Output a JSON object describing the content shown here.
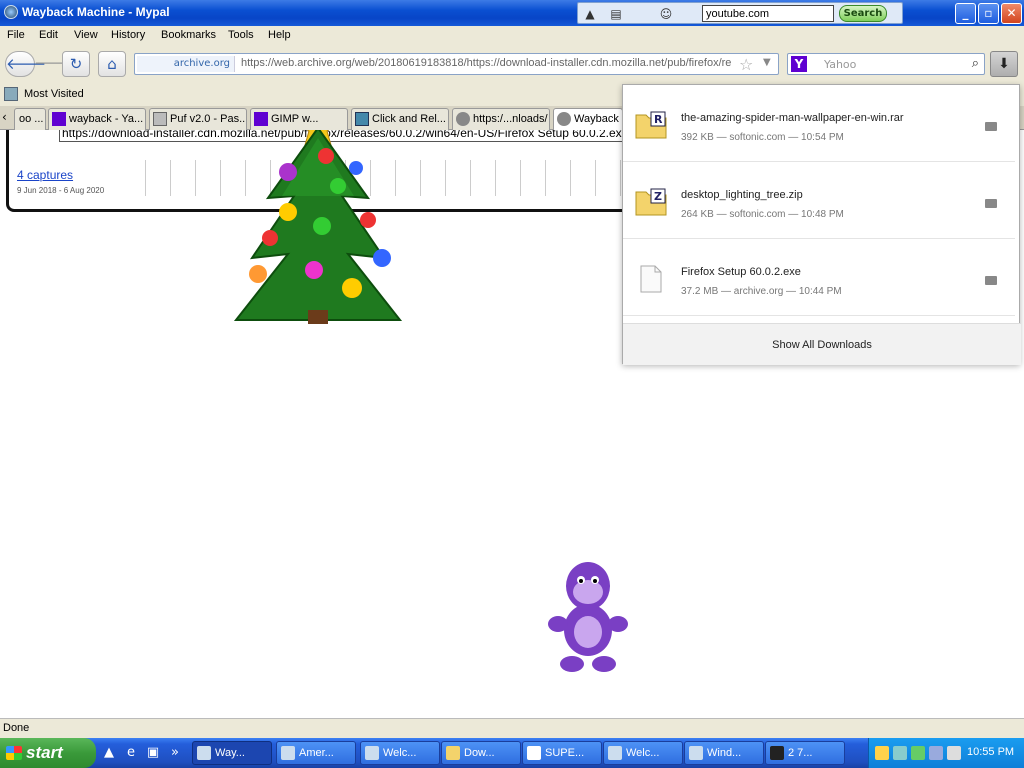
{
  "window": {
    "title": "Wayback Machine - Mypal"
  },
  "toolbar_strip": {
    "search_value": "youtube.com",
    "search_button": "Search"
  },
  "menu": [
    "File",
    "Edit",
    "View",
    "History",
    "Bookmarks",
    "Tools",
    "Help"
  ],
  "nav": {
    "identity": "archive.org",
    "url": "https://web.archive.org/web/20180619183818/https://download-installer.cdn.mozilla.net/pub/firefox/re",
    "search_engine": "Yahoo",
    "search_placeholder": "Yahoo"
  },
  "bookmarks": {
    "most_visited": "Most Visited"
  },
  "tabs": [
    {
      "label": "oo ..."
    },
    {
      "label": "wayback - Ya..."
    },
    {
      "label": "Puf v2.0 - Pas..."
    },
    {
      "label": "GIMP w..."
    },
    {
      "label": "Click and Rel..."
    },
    {
      "label": "https:/...nloads/"
    },
    {
      "label": "Wayback"
    }
  ],
  "page": {
    "url_text": "https://download-installer.cdn.mozilla.net/pub/firefox/releases/60.0.2/win64/en-US/Firefox Setup 60.0.2.exe",
    "captures": "4 captures",
    "dates": "9 Jun 2018 - 6 Aug 2020"
  },
  "downloads": {
    "items": [
      {
        "name": "the-amazing-spider-man-wallpaper-en-win.rar",
        "meta": "392 KB — softonic.com — 10:54 PM",
        "icon": "rar-icon"
      },
      {
        "name": "desktop_lighting_tree.zip",
        "meta": "264 KB — softonic.com — 10:48 PM",
        "icon": "zip-icon"
      },
      {
        "name": "Firefox Setup 60.0.2.exe",
        "meta": "37.2 MB — archive.org — 10:44 PM",
        "icon": "exe-icon"
      }
    ],
    "show_all": "Show All Downloads"
  },
  "status": {
    "text": "Done"
  },
  "taskbar": {
    "start": "start",
    "tasks": [
      {
        "label": "Way..."
      },
      {
        "label": "Amer..."
      },
      {
        "label": "Welc..."
      },
      {
        "label": "Dow..."
      },
      {
        "label": "SUPE..."
      },
      {
        "label": "Welc..."
      },
      {
        "label": "Wind..."
      },
      {
        "label": "2 7..."
      }
    ],
    "clock": "10:55 PM"
  },
  "colors": {
    "titlebar": "#0a4fd1",
    "link": "#1a44c8",
    "taskbar": "#245edb",
    "start": "#3a9a3a"
  }
}
